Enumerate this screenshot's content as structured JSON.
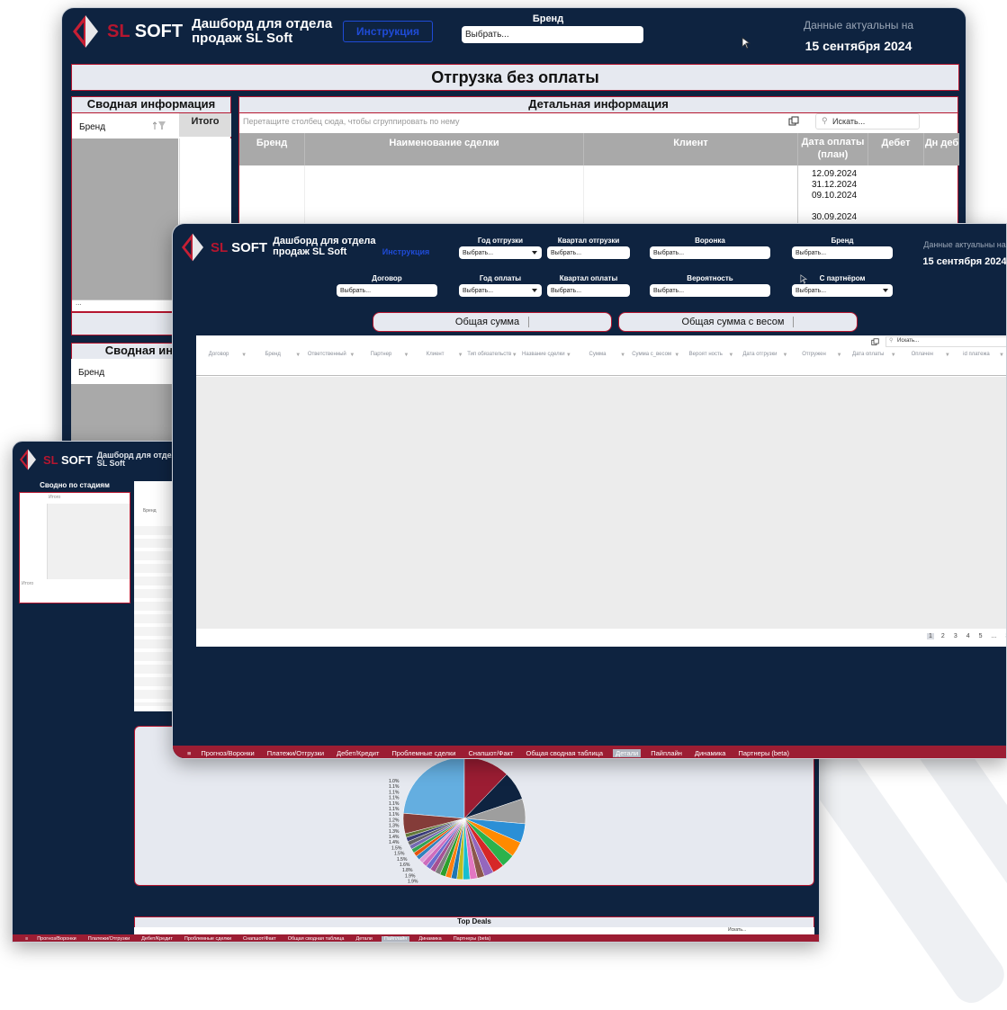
{
  "app": {
    "brand_sl": "SL",
    "brand_soft": "SOFT",
    "subtitle_line1": "Дашборд для отдела",
    "subtitle_line2": "продаж SL Soft",
    "subtitle_small_line1": "Дашборд для отдела",
    "subtitle_small_line2": "SL Soft",
    "instructions_label": "Инструкция",
    "data_actual_label": "Данные актуальны на",
    "data_actual_date": "15 сентября 2024",
    "select_placeholder": "Выбрать..."
  },
  "back_window": {
    "brand_filter_label": "Бренд",
    "band_title": "Отгрузка без оплаты",
    "summary_title": "Сводная информация",
    "summary_title_2": "Сводная инфор",
    "summary_cols": [
      "Бренд",
      "Итого"
    ],
    "detail_title": "Детальная информация",
    "group_hint": "Перетащите столбец сюда, чтобы сгруппировать по нему",
    "search_placeholder": "Искать...",
    "detail_cols": [
      "Бренд",
      "Наименование сделки",
      "Клиент",
      "Дата оплаты (план)",
      "Дебет",
      "Дн деб"
    ],
    "dates": [
      "12.09.2024",
      "31.12.2024",
      "09.10.2024",
      "30.09.2024"
    ],
    "ellipsis": "..."
  },
  "left_window": {
    "stages_title": "Сводно по стадиям",
    "itogo": "Итого",
    "brand": "Бренд",
    "top_deals": "Top Deals",
    "search_placeholder": "Искать...",
    "pie_labels": [
      "Прочее: 23.3%",
      "1.0%",
      "1.1%",
      "1.1%",
      "1.1%",
      "1.1%",
      "1.1%",
      "1.1%",
      "1.2%",
      "1.3%",
      "1.3%",
      "1.4%",
      "1.4%",
      "1.5%",
      "1.5%",
      "1.5%",
      "1.6%",
      "1.8%",
      "1.9%",
      "1.9%"
    ],
    "tabs": [
      "Прогноз/Воронки",
      "Платежи/Отгрузки",
      "Дебет/Кредит",
      "Проблемные сделки",
      "Снапшот/Факт",
      "Общая сводная таблица",
      "Детали",
      "Пайплайн",
      "Динамика",
      "Партнеры (beta)"
    ],
    "active_tab_index": 7
  },
  "front_window": {
    "filters_row1": [
      "Год отгрузки",
      "Квартал отгрузки",
      "Воронка",
      "Бренд"
    ],
    "filters_row2": [
      "Договор",
      "Год оплаты",
      "Квартал оплаты",
      "Вероятность",
      "С партнёром"
    ],
    "sum_buttons": [
      "Общая сумма",
      "Общая сумма с весом"
    ],
    "search_placeholder": "Искать...",
    "columns": [
      "Договор",
      "Бренд",
      "Ответственный",
      "Партнер",
      "Клиент",
      "Тип обязательств",
      "Название сделки",
      "Сумма",
      "Сумма с_весом",
      "Вероят ность",
      "Дата отгрузки",
      "Отгружен",
      "Дата оплаты",
      "Оплачен",
      "id платежа"
    ],
    "pages": [
      "1",
      "2",
      "3",
      "4",
      "5",
      "...",
      "3"
    ],
    "tabs": [
      "Прогноз/Воронки",
      "Платежи/Отгрузки",
      "Дебет/Кредит",
      "Проблемные сделки",
      "Снапшот/Факт",
      "Общая сводная таблица",
      "Детали",
      "Пайплайн",
      "Динамика",
      "Партнеры (beta)"
    ],
    "active_tab_index": 6
  },
  "colors": {
    "navy": "#0e2340",
    "crimson": "#b5162f",
    "tab_bar": "#9c1d33",
    "panel_bg": "#e6e9f0",
    "gray_cell": "#a9a9a9"
  },
  "pie_chart": {
    "slices_percent": [
      23.3,
      12.0,
      7.5,
      6.5,
      5.0,
      4.0,
      3.5,
      3.0,
      2.5,
      1.9,
      1.9,
      1.8,
      1.6,
      1.5,
      1.5,
      1.5,
      1.4,
      1.4,
      1.3,
      1.3,
      1.2,
      1.1,
      1.1,
      1.1,
      1.1,
      1.1,
      1.1,
      1.0,
      5.3
    ]
  }
}
